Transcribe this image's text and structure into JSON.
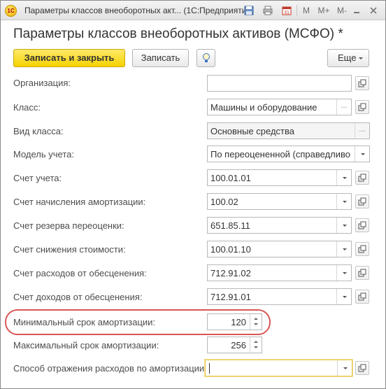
{
  "window": {
    "title": "Параметры классов внеоборотных акт...  (1С:Предприятие)",
    "toolbar": {
      "m": "M",
      "m_plus": "M+",
      "m_minus": "M-"
    }
  },
  "form": {
    "title": "Параметры классов внеоборотных активов (МСФО) *"
  },
  "commandbar": {
    "save_close": "Записать и закрыть",
    "save": "Записать",
    "more": "Еще"
  },
  "fields": {
    "organization": {
      "label": "Организация:",
      "value": ""
    },
    "class": {
      "label": "Класс:",
      "value": "Машины и оборудование"
    },
    "class_kind": {
      "label": "Вид класса:",
      "value": "Основные средства"
    },
    "accounting_model": {
      "label": "Модель учета:",
      "value": "По переоцененной (справедливой"
    },
    "account": {
      "label": "Счет учета:",
      "value": "100.01.01"
    },
    "depreciation_account": {
      "label": "Счет начисления амортизации:",
      "value": "100.02"
    },
    "revaluation_reserve_account": {
      "label": "Счет резерва переоценки:",
      "value": "651.85.11"
    },
    "impairment_account": {
      "label": "Счет снижения стоимости:",
      "value": "100.01.10"
    },
    "impairment_expense_account": {
      "label": "Счет расходов от обесценения:",
      "value": "712.91.02"
    },
    "impairment_income_account": {
      "label": "Счет доходов от обесценения:",
      "value": "712.91.01"
    },
    "min_useful_life": {
      "label": "Минимальный срок амортизации:",
      "value": "120"
    },
    "max_useful_life": {
      "label": "Максимальный срок амортизации:",
      "value": "256"
    },
    "depreciation_expense_method": {
      "label": "Способ отражения расходов по амортизации:",
      "value": ""
    }
  }
}
